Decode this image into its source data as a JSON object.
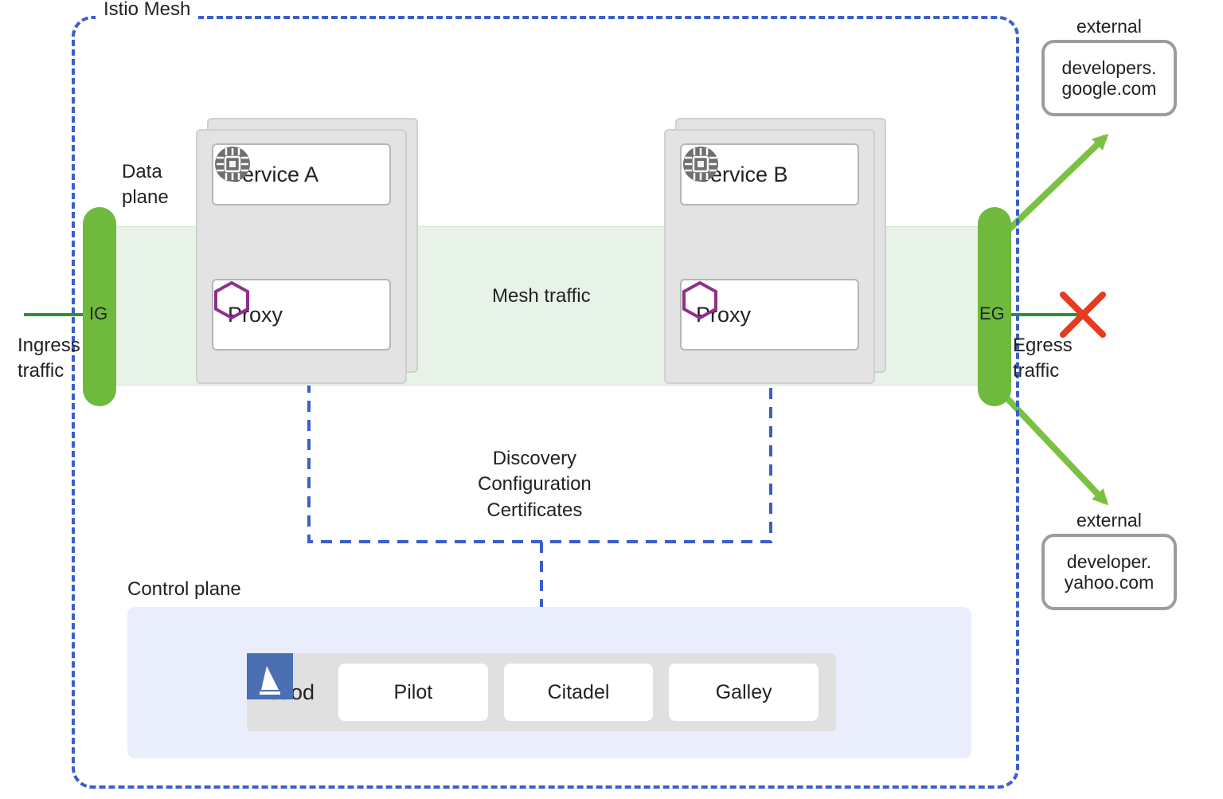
{
  "mesh": {
    "title": "Istio Mesh"
  },
  "plane": {
    "data": "Data\nplane",
    "control": "Control plane"
  },
  "gateway": {
    "ingress": "IG",
    "egress": "EG",
    "ingressTraffic": "Ingress\ntraffic",
    "egressTraffic": "Egress\ntraffic"
  },
  "services": {
    "a": "Service A",
    "b": "Service B",
    "proxy": "Proxy",
    "mesh_traffic": "Mesh traffic"
  },
  "control": {
    "istiod": "istiod",
    "components": [
      "Pilot",
      "Citadel",
      "Galley"
    ],
    "funcs": [
      "Discovery",
      "Configuration",
      "Certificates"
    ]
  },
  "external": {
    "label": "external",
    "endpoints": [
      "developers. google.com",
      "developer. yahoo.com"
    ]
  }
}
